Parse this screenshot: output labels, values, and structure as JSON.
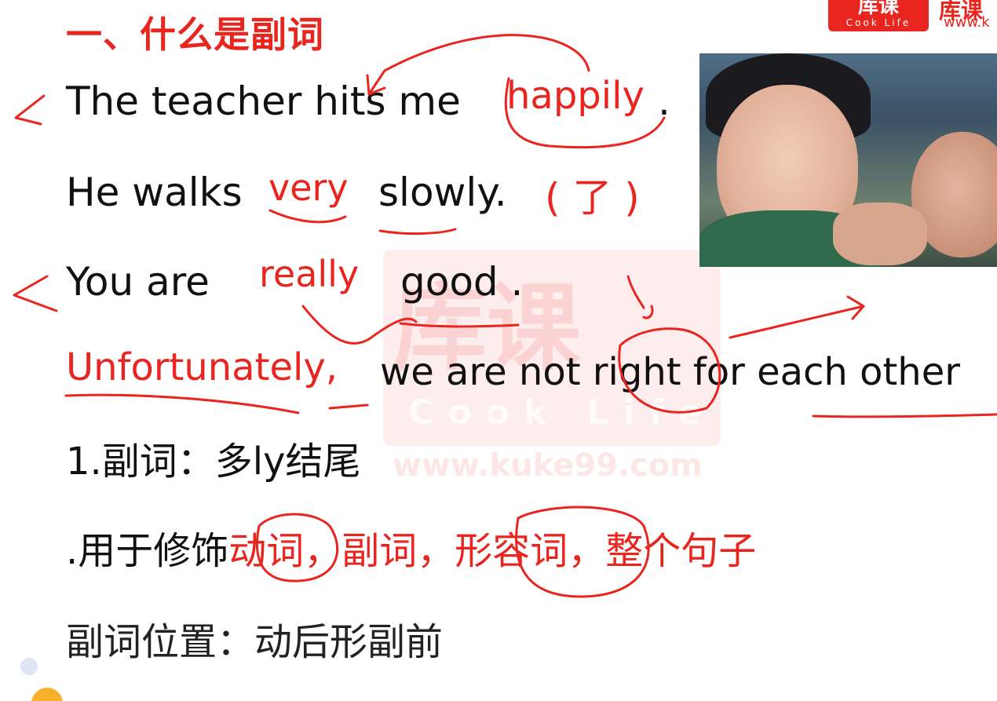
{
  "logo": {
    "cn": "库课",
    "en": "Cook Life",
    "side_cn": "库课",
    "url": "www.k"
  },
  "watermark": {
    "cn": "库课",
    "en": "Cook Life",
    "url": "www.kuke99.com"
  },
  "slide": {
    "title": "一、什么是副词",
    "line1": {
      "text": "The teacher hits me",
      "ann": "happily",
      "end": "."
    },
    "line2": {
      "pre": "He walks",
      "ann": "very",
      "post": "slowly.",
      "ann2": "( 了 )"
    },
    "line3": {
      "pre": "You are",
      "ann": "really",
      "post": "good  ."
    },
    "line4": {
      "ann": "Unfortunately,",
      "post": "we are not right for each other"
    },
    "point1": "1.副词：多ly结尾",
    "point2_pre": ".用于修饰",
    "point2_red": "动词，副词，形容词，整个句子",
    "point3": "副词位置：动后形副前"
  },
  "colors": {
    "accent_red": "#e8261f",
    "text": "#111111"
  }
}
